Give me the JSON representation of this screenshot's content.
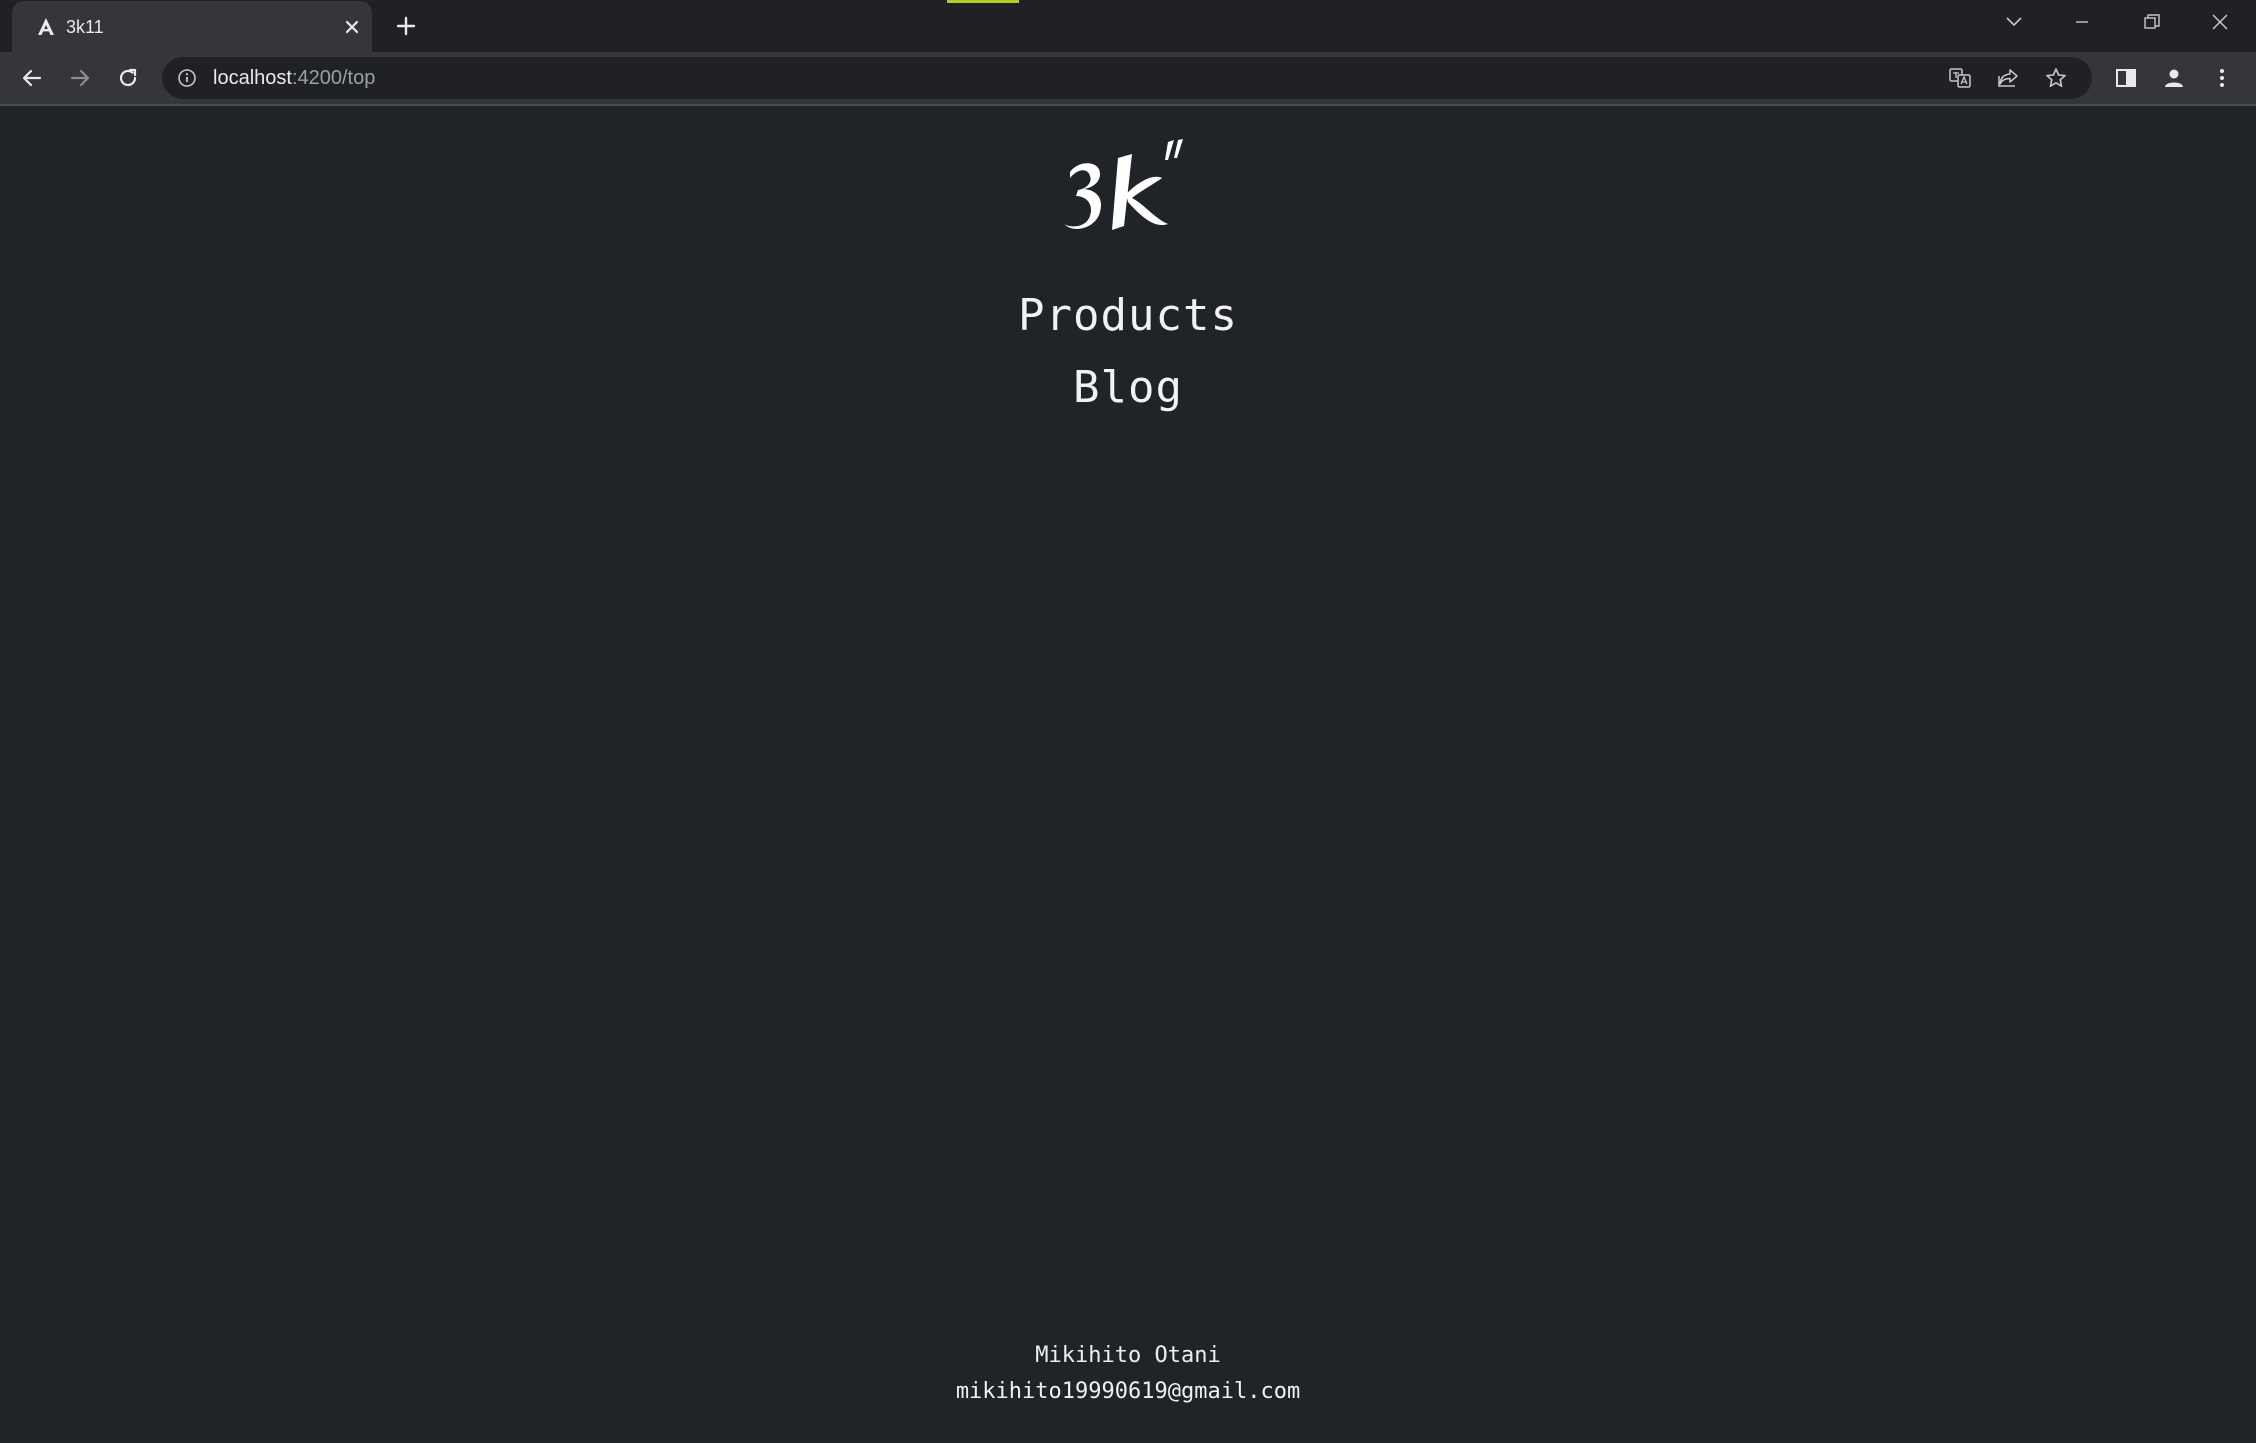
{
  "browser": {
    "tab": {
      "title": "3k11",
      "favicon": "angular-icon"
    },
    "new_tab_label": "+",
    "url": {
      "host": "localhost",
      "path": ":4200/top"
    },
    "window_controls": [
      "chevron-down-icon",
      "minimize-icon",
      "restore-icon",
      "close-icon"
    ],
    "toolbar_icons": [
      "translate-icon",
      "share-icon",
      "star-icon",
      "side-panel-icon",
      "profile-icon",
      "more-vert-icon"
    ]
  },
  "page": {
    "logo_text": "3k\"",
    "nav": {
      "products": "Products",
      "blog": "Blog"
    },
    "footer": {
      "name": "Mikihito Otani",
      "email": "mikihito19990619@gmail.com"
    }
  },
  "colors": {
    "background": "#202328",
    "text": "#f2f2f2",
    "loading_indicator": "#b5cc18"
  }
}
